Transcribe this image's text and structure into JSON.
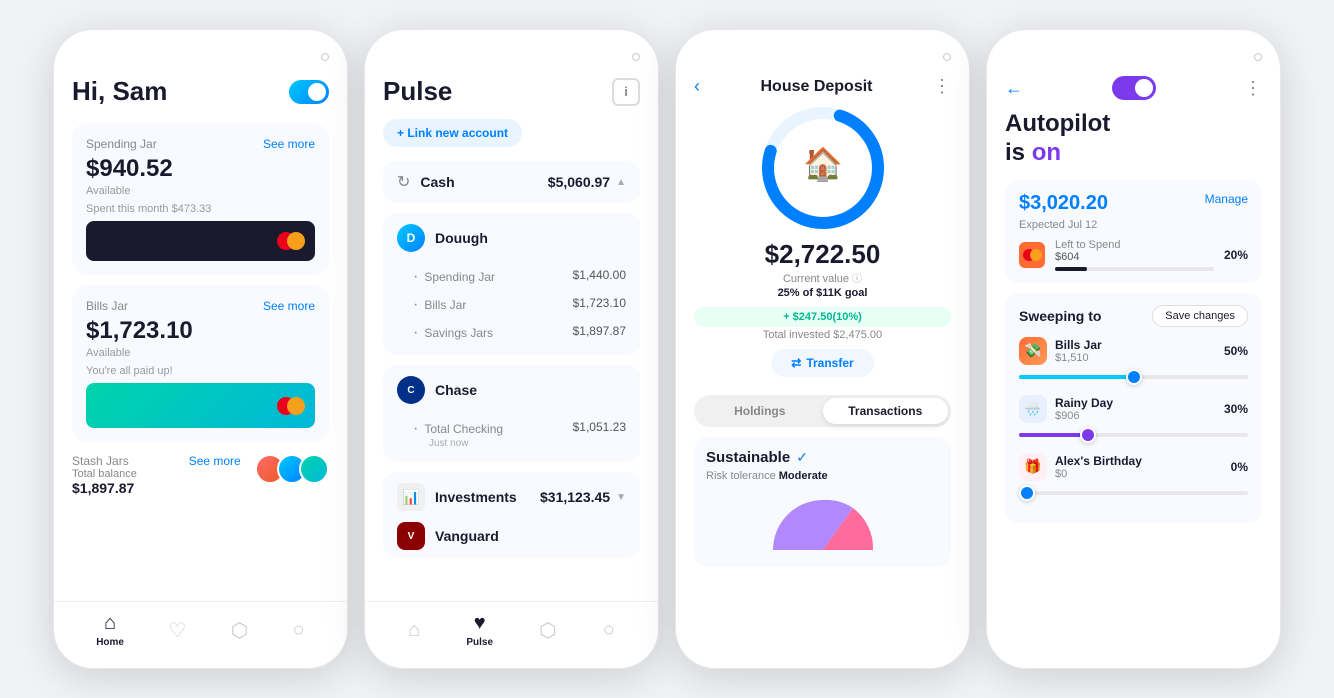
{
  "phone1": {
    "greeting": "Hi, Sam",
    "jar1": {
      "label": "Spending Jar",
      "amount": "$940.52",
      "available": "Available",
      "spent": "Spent this month $473.33",
      "see_more": "See more"
    },
    "jar2": {
      "label": "Bills Jar",
      "amount": "$1,723.10",
      "available": "Available",
      "note": "You're all paid up!",
      "see_more": "See more"
    },
    "stash": {
      "label": "Stash Jars",
      "balance_label": "Total balance",
      "amount": "$1,897.87",
      "see_more": "See more"
    },
    "nav": {
      "home": "Home",
      "favorites": "",
      "jars": "",
      "profile": ""
    }
  },
  "phone2": {
    "title": "Pulse",
    "link_account": "+ Link new account",
    "cash": {
      "label": "Cash",
      "amount": "$5,060.97"
    },
    "dough": {
      "name": "Douugh",
      "spending_jar": "$1,440.00",
      "bills_jar": "$1,723.10",
      "savings_jars": "$1,897.87"
    },
    "chase": {
      "name": "Chase",
      "sub_label": "Total Checking",
      "sub_time": "Just now",
      "amount": "$1,051.23"
    },
    "investments": {
      "label": "Investments",
      "amount": "$31,123.45"
    },
    "vanguard": {
      "name": "Vanguard"
    },
    "nav": {
      "home": "",
      "pulse": "Pulse"
    }
  },
  "phone3": {
    "title": "House Deposit",
    "amount": "$2,722.50",
    "current_value": "Current value",
    "goal_progress": "25% of $11K goal",
    "growth": "+ $247.50(10%)",
    "total_invested": "Total invested $2,475.00",
    "transfer_btn": "Transfer",
    "tabs": {
      "holdings": "Holdings",
      "transactions": "Transactions"
    },
    "sustainable": {
      "name": "Sustainable",
      "risk_label": "Risk tolerance",
      "risk_value": "Moderate"
    }
  },
  "phone4": {
    "title_line1": "Autopilot",
    "title_line2": "is",
    "title_on": "on",
    "expected_amount": "$3,020.20",
    "expected_date": "Expected Jul 12",
    "manage": "Manage",
    "left_to_spend_label": "Left to Spend",
    "left_to_spend_amount": "$604",
    "left_to_spend_pct": "20%",
    "sweeping_title": "Sweeping to",
    "save_changes": "Save changes",
    "items": [
      {
        "name": "Bills Jar",
        "amount": "$1,510",
        "pct": "50%",
        "fill_pct": 50,
        "color": "#00c9ff"
      },
      {
        "name": "Rainy Day",
        "amount": "$906",
        "pct": "30%",
        "fill_pct": 30,
        "color": "#7c3aed"
      },
      {
        "name": "Alex's Birthday",
        "amount": "$0",
        "pct": "0%",
        "fill_pct": 0,
        "color": "#0080ff"
      }
    ]
  }
}
